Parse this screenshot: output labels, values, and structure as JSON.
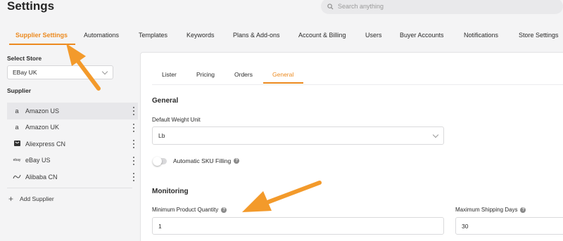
{
  "header": {
    "title": "Settings",
    "search_placeholder": "Search anything"
  },
  "top_tabs": [
    {
      "label": "Supplier Settings",
      "active": true
    },
    {
      "label": "Automations"
    },
    {
      "label": "Templates"
    },
    {
      "label": "Keywords"
    },
    {
      "label": "Plans & Add-ons"
    },
    {
      "label": "Account & Billing"
    },
    {
      "label": "Users"
    },
    {
      "label": "Buyer Accounts"
    },
    {
      "label": "Notifications"
    },
    {
      "label": "Store Settings"
    }
  ],
  "sidebar": {
    "select_store_label": "Select Store",
    "selected_store": "EBay UK",
    "supplier_heading": "Supplier",
    "suppliers": [
      {
        "label": "Amazon US",
        "icon": "amazon-icon",
        "selected": true
      },
      {
        "label": "Amazon UK",
        "icon": "amazon-icon"
      },
      {
        "label": "Aliexpress CN",
        "icon": "aliexpress-icon"
      },
      {
        "label": "eBay US",
        "icon": "ebay-icon"
      },
      {
        "label": "Alibaba CN",
        "icon": "alibaba-icon"
      }
    ],
    "add_supplier_label": "Add Supplier"
  },
  "panel": {
    "sub_tabs": [
      {
        "label": "Lister"
      },
      {
        "label": "Pricing"
      },
      {
        "label": "Orders"
      },
      {
        "label": "General",
        "active": true
      }
    ],
    "general": {
      "title": "General",
      "weight_unit_label": "Default Weight Unit",
      "weight_unit_value": "Lb",
      "auto_sku_label": "Automatic SKU Filling",
      "auto_sku_enabled": false
    },
    "monitoring": {
      "title": "Monitoring",
      "min_qty_label": "Minimum Product Quantity",
      "min_qty_value": "1",
      "max_ship_label": "Maximum Shipping Days",
      "max_ship_value": "30"
    }
  },
  "colors": {
    "accent": "#ec8a1f",
    "arrow": "#f39a2b"
  }
}
